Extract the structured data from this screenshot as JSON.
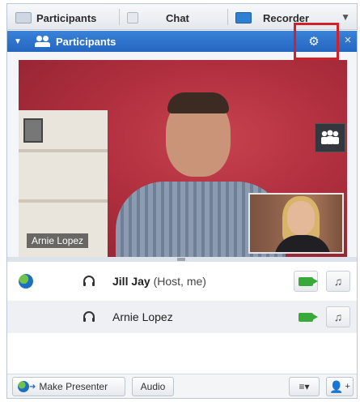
{
  "tabs": [
    {
      "label": "Participants",
      "icon": "participants-tab-icon"
    },
    {
      "label": "Chat",
      "icon": "chat-tab-icon"
    },
    {
      "label": "Recorder",
      "icon": "recorder-tab-icon"
    }
  ],
  "panel": {
    "title": "Participants",
    "settings_icon": "gear-icon",
    "close_label": "×",
    "collapse_label": "▼"
  },
  "video": {
    "main_speaker_name": "Arnie Lopez"
  },
  "participants": [
    {
      "name": "Jill Jay",
      "role": "(Host, me)",
      "presenter": true,
      "video_on": true
    },
    {
      "name": "Arnie Lopez",
      "role": "",
      "presenter": false,
      "video_on": true
    }
  ],
  "toolbar": {
    "make_presenter_label": "Make Presenter",
    "audio_label": "Audio",
    "menu_label": "≡▾",
    "add_label": "+"
  },
  "colors": {
    "panel_header": "#2466c0",
    "highlight": "#d0202a",
    "video_active": "#39a93a"
  }
}
